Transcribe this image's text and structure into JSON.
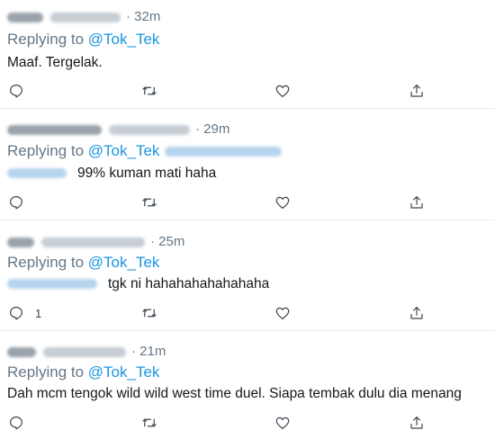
{
  "tweets": [
    {
      "time": "· 32m",
      "replying_prefix": "Replying to ",
      "replying_handle": "@Tok_Tek",
      "text": "Maaf. Tergelak.",
      "reply_count": ""
    },
    {
      "time": "· 29m",
      "replying_prefix": "Replying to ",
      "replying_handle": "@Tok_Tek",
      "text": "99% kuman mati haha",
      "reply_count": ""
    },
    {
      "time": "· 25m",
      "replying_prefix": "Replying to ",
      "replying_handle": "@Tok_Tek",
      "text": "tgk ni hahahahahahahaha",
      "reply_count": "1"
    },
    {
      "time": "· 21m",
      "replying_prefix": "Replying to ",
      "replying_handle": "@Tok_Tek",
      "text": "Dah mcm tengok wild wild west time duel. Siapa tembak dulu dia menang",
      "reply_count": ""
    }
  ],
  "icons": {
    "reply": "reply-icon",
    "retweet": "retweet-icon",
    "like": "heart-icon",
    "share": "share-icon"
  },
  "colors": {
    "link": "#1b95e0",
    "secondary_text": "#657786",
    "divider": "#e6ecf0"
  }
}
